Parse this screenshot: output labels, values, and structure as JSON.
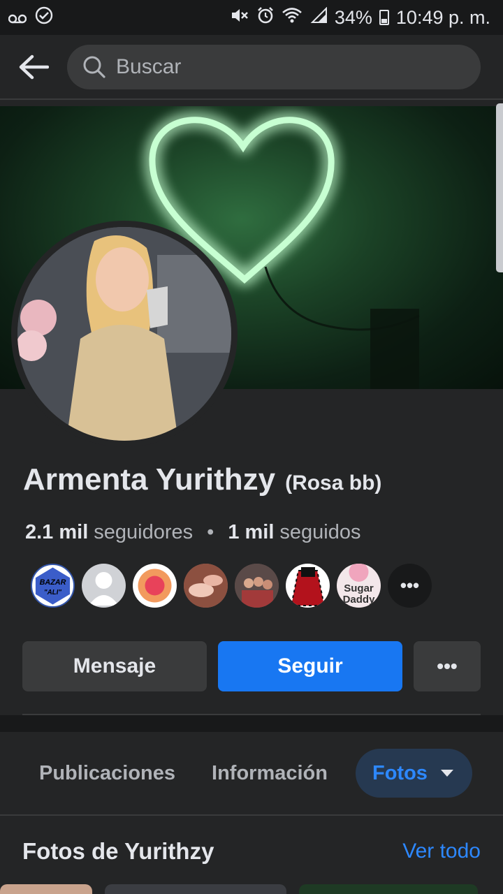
{
  "status_bar": {
    "battery": "34%",
    "time": "10:49 p. m."
  },
  "search": {
    "placeholder": "Buscar"
  },
  "profile": {
    "name": "Armenta Yurithzy",
    "alternate_name": "(Rosa bb)",
    "followers_count": "2.1 mil",
    "followers_label": "seguidores",
    "following_count": "1 mil",
    "following_label": "seguidos"
  },
  "follower_avatars": [
    {
      "text": "BAZAR \"ALI\"",
      "color": "#3355aa"
    },
    {
      "text": "",
      "color": "#d0d2d6"
    },
    {
      "text": "",
      "color": "#f29a5e"
    },
    {
      "text": "",
      "color": "#b26b5a"
    },
    {
      "text": "",
      "color": "#6a4f4b"
    },
    {
      "text": "",
      "color": "#b3121c"
    },
    {
      "text": "Sugar Daddy",
      "color": "#f3e7ea"
    }
  ],
  "actions": {
    "message": "Mensaje",
    "follow": "Seguir",
    "more": "•••"
  },
  "tabs": [
    {
      "label": "Publicaciones"
    },
    {
      "label": "Información"
    },
    {
      "label": "Fotos"
    }
  ],
  "photos_section": {
    "title": "Fotos de Yurithzy",
    "see_all": "Ver todo"
  },
  "colors": {
    "background": "#242526",
    "accent": "#1877f2",
    "link": "#2d88ff"
  }
}
